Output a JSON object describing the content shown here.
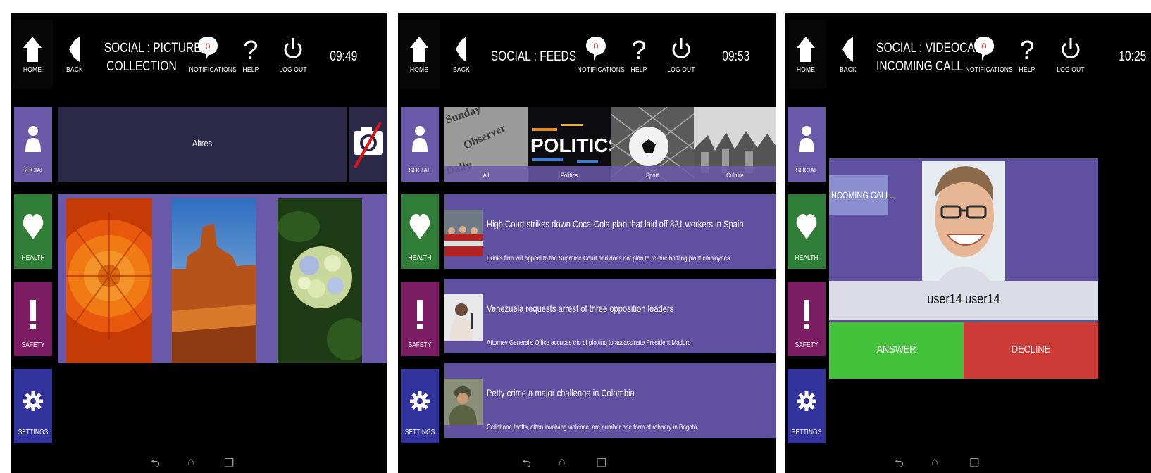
{
  "common": {
    "nav": {
      "home": "HOME",
      "back": "BACK",
      "notifications": "NOTIFICATIONS",
      "help": "HELP",
      "logout": "LOG OUT",
      "notification_count": "0"
    },
    "sidebar": {
      "social": "SOCIAL",
      "health": "HEALTH",
      "safety": "SAFETY",
      "settings": "SETTINGS"
    },
    "sysnav_icons": [
      "back-icon",
      "home-icon",
      "recents-icon"
    ]
  },
  "screen1": {
    "title_line1": "SOCIAL : PICTURES :",
    "title_line2": "COLLECTION",
    "time": "09:49",
    "album_label": "Altres",
    "photos": [
      "flower-orange-photo",
      "desert-butte-photo",
      "hydrangea-photo"
    ]
  },
  "screen2": {
    "title": "SOCIAL : FEEDS",
    "time": "09:53",
    "categories": [
      "All",
      "Politics",
      "Sport",
      "Culture"
    ],
    "politics_image_text": "POLITICS",
    "news": [
      {
        "headline": "High Court strikes down Coca-Cola plan that laid off 821 workers in Spain",
        "summary": "Drinks firm will appeal to the Supreme Court and does not plan to re-hire bottling plant employees"
      },
      {
        "headline": "Venezuela requests arrest of three opposition leaders",
        "summary": "Attorney General's Office accuses trio of plotting to assassinate President Maduro"
      },
      {
        "headline": "Petty crime a major challenge in Colombia",
        "summary": "Cellphone thefts, often involving violence, are number one form of robbery in Bogotá"
      }
    ]
  },
  "screen3": {
    "title_line1": "SOCIAL : VIDEOCALL :",
    "title_line2": "INCOMING CALL",
    "time": "10:25",
    "incoming_label": "INCOMING CALL...",
    "caller_name": "user14 user14",
    "answer": "ANSWER",
    "decline": "DECLINE"
  },
  "colors": {
    "social": "#6a59a8",
    "health": "#2f7d36",
    "safety": "#7c1d63",
    "settings": "#33339d",
    "answer": "#45c23b",
    "decline": "#cc3a36"
  }
}
